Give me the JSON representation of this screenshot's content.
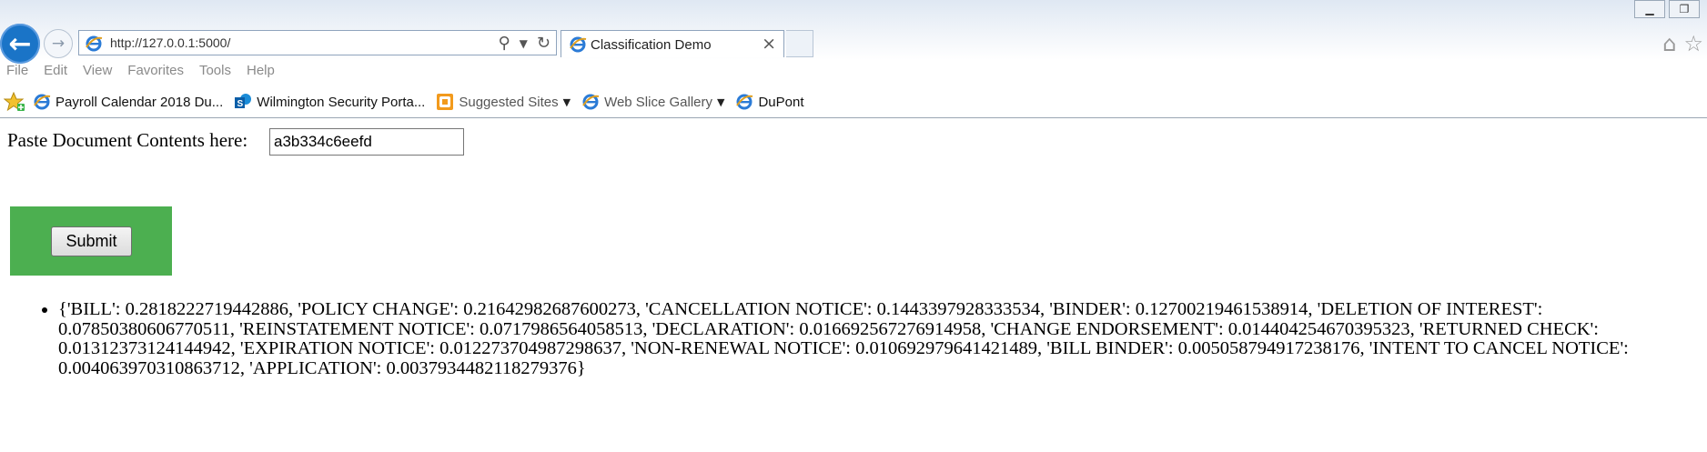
{
  "browser": {
    "url": "http://127.0.0.1:5000/",
    "tab_title": "Classification Demo",
    "accent": "#1a74c7"
  },
  "menu": [
    "File",
    "Edit",
    "View",
    "Favorites",
    "Tools",
    "Help"
  ],
  "favorites": [
    {
      "label": "Payroll Calendar 2018 Du...",
      "icon": "ie-icon"
    },
    {
      "label": "Wilmington Security Porta...",
      "icon": "sharepoint-icon"
    },
    {
      "label": "Suggested Sites",
      "icon": "suggested-sites-icon",
      "dropdown": true
    },
    {
      "label": "Web Slice Gallery",
      "icon": "ie-icon",
      "dropdown": true
    },
    {
      "label": "DuPont",
      "icon": "ie-icon"
    }
  ],
  "form": {
    "label": "Paste Document Contents here:",
    "input_value": "a3b334c6eefd",
    "submit_label": "Submit",
    "button_bg": "#4caf50"
  },
  "result": "{'BILL': 0.2818222719442886, 'POLICY CHANGE': 0.21642982687600273, 'CANCELLATION NOTICE': 0.1443397928333534, 'BINDER': 0.12700219461538914, 'DELETION OF INTEREST': 0.07850380606770511, 'REINSTATEMENT NOTICE': 0.0717986564058513, 'DECLARATION': 0.016692567276914958, 'CHANGE ENDORSEMENT': 0.014404254670395323, 'RETURNED CHECK': 0.01312373124144942, 'EXPIRATION NOTICE': 0.012273704987298637, 'NON-RENEWAL NOTICE': 0.010692979641421489, 'BILL BINDER': 0.005058794917238176, 'INTENT TO CANCEL NOTICE': 0.004063970310863712, 'APPLICATION': 0.0037934482118279376}"
}
